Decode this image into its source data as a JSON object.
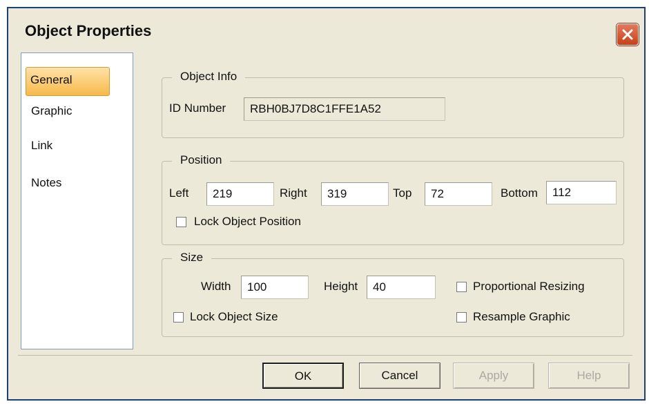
{
  "window": {
    "title": "Object Properties"
  },
  "nav": {
    "items": [
      "General",
      "Graphic",
      "Link",
      "Notes"
    ],
    "selected": "General"
  },
  "object_info": {
    "legend": "Object Info",
    "id_label": "ID Number",
    "id_value": "RBH0BJ7D8C1FFE1A52"
  },
  "position": {
    "legend": "Position",
    "left_label": "Left",
    "left_value": "219",
    "right_label": "Right",
    "right_value": "319",
    "top_label": "Top",
    "top_value": "72",
    "bottom_label": "Bottom",
    "bottom_value": "112",
    "lock_label": "Lock Object Position",
    "lock_checked": false
  },
  "size": {
    "legend": "Size",
    "width_label": "Width",
    "width_value": "100",
    "height_label": "Height",
    "height_value": "40",
    "proportional_label": "Proportional Resizing",
    "proportional_checked": false,
    "lock_label": "Lock Object Size",
    "lock_checked": false,
    "resample_label": "Resample Graphic",
    "resample_checked": false
  },
  "buttons": {
    "ok": "OK",
    "cancel": "Cancel",
    "apply": "Apply",
    "help": "Help"
  },
  "colors": {
    "title_bar_border": "#1f3f78",
    "close_button": "#c8401b",
    "selected_tab": "#f6b94b",
    "dialog_bg": "#ece9d8"
  }
}
